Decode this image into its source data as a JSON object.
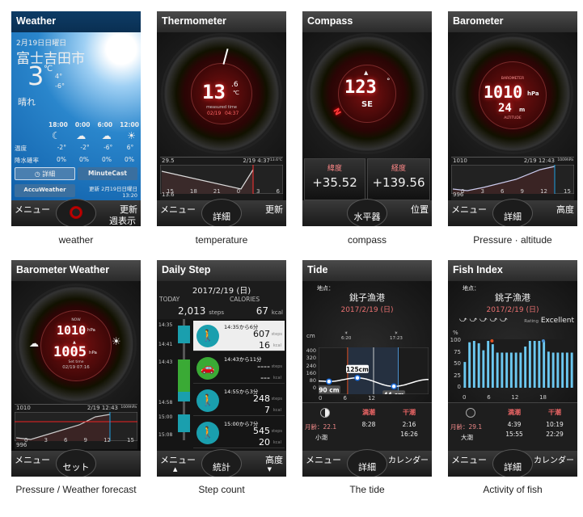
{
  "screens": [
    {
      "title": "Weather",
      "caption": "weather",
      "date": "2月19日日曜日",
      "city": "富士吉田市",
      "temp": "3",
      "unit": "℃",
      "high": "4°",
      "low": "-6°",
      "condition": "晴れ",
      "hours": [
        "18:00",
        "0:00",
        "6:00",
        "12:00"
      ],
      "hour_icons": [
        "moon-icon",
        "cloud-icon",
        "cloud-moon-icon",
        "sun-icon"
      ],
      "temp_label": "温度",
      "temps": [
        "-2°",
        "-2°",
        "-6°",
        "6°"
      ],
      "rain_label": "降水確率",
      "rains": [
        "0%",
        "0%",
        "0%",
        "0%"
      ],
      "detail_btn": "詳細",
      "minutecast": "MinuteCast",
      "accuweather": "AccuWeather",
      "updated": "更新 2月19日日曜日",
      "updated_time": "13:20",
      "nav": {
        "left": "メニュー",
        "right": "更新",
        "right2": "週表示"
      }
    },
    {
      "title": "Thermometer",
      "caption": "temperature",
      "value": "13",
      "decimal": ".6",
      "unit": "℃",
      "measured_label": "measured time",
      "measured_date": "02/19",
      "measured_time": "04:37",
      "chart_max": "29.5",
      "chart_min": "13.6",
      "chart_stamp": "2/19 4:37",
      "chart_stamp_val": "13.6℃",
      "ticks": [
        "15",
        "18",
        "21",
        "0",
        "3",
        "6"
      ],
      "nav": {
        "left": "メニュー",
        "center": "詳細",
        "right": "更新"
      }
    },
    {
      "title": "Compass",
      "caption": "compass",
      "heading": "123",
      "deg": "°",
      "direction": "SE",
      "lat_label": "緯度",
      "lat": "+35.52",
      "lon_label": "経度",
      "lon": "+139.56",
      "nav": {
        "center": "水平器",
        "right": "位置"
      }
    },
    {
      "title": "Barometer",
      "caption": "Pressure · altitude",
      "gauge_label": "BAROMETER",
      "pressure": "1010",
      "pressure_unit": "hPa",
      "altitude": "24",
      "altitude_unit": "m",
      "altitude_label": "ALTITUDE",
      "scale": [
        "900",
        "925",
        "950",
        "975",
        "1000",
        "1025",
        "1050"
      ],
      "chart_max": "1010",
      "chart_min": "996",
      "chart_stamp": "2/19 12:43",
      "chart_stamp_val": "1009hPa",
      "ticks": [
        "0",
        "3",
        "6",
        "9",
        "12",
        "15"
      ],
      "nav": {
        "left": "メニュー",
        "center": "詳細",
        "right": "高度"
      }
    },
    {
      "title": "Barometer Weather",
      "caption": "Pressure / Weather forecast",
      "now_label": "NOW",
      "now": "1010",
      "set": "1005",
      "unit": "hPa",
      "set_label": "Set time",
      "set_time": "02/19 07:16",
      "chart_max": "1010",
      "chart_min": "996",
      "chart_stamp": "2/19 12:43",
      "chart_stamp_val": "1009hPa",
      "ticks": [
        "0",
        "3",
        "6",
        "9",
        "12",
        "15"
      ],
      "nav": {
        "left": "メニュー",
        "center": "セット"
      }
    },
    {
      "title": "Daily Step",
      "caption": "Step count",
      "date": "2017/2/19 (日)",
      "today_label": "TODAY",
      "steps": "2,013",
      "steps_unit": "steps",
      "cal_label": "CALORIES",
      "cal": "67",
      "cal_unit": "kcal",
      "times": [
        "14:35",
        "14:41",
        "14:43",
        "14:58",
        "15:00",
        "15:08"
      ],
      "entries": [
        {
          "time": "14:35から6分",
          "steps": "607",
          "kcal": "16",
          "type": "walk",
          "color": "#1a9fae"
        },
        {
          "time": "14:43から11分",
          "steps": "----",
          "kcal": "---",
          "type": "vehicle",
          "color": "#3aaa35"
        },
        {
          "time": "14:55から3分",
          "steps": "248",
          "kcal": "7",
          "type": "walk",
          "color": "#1a9fae"
        },
        {
          "time": "15:00から7分",
          "steps": "545",
          "kcal": "20",
          "type": "walk",
          "color": "#1a9fae"
        }
      ],
      "nav": {
        "left": "メニュー",
        "center": "統計",
        "right": "高度"
      }
    },
    {
      "title": "Tide",
      "caption": "The tide",
      "loc_label": "地点：",
      "location": "銚子漁港",
      "date": "2017/2/19 (日)",
      "unit": "cm",
      "sunrise": "6:20",
      "sunset": "17:23",
      "yticks": [
        "400",
        "320",
        "240",
        "160",
        "80",
        "0"
      ],
      "xticks": [
        "0",
        "6",
        "12"
      ],
      "chart_data": {
        "type": "line",
        "x_unit": "hour",
        "y_unit": "cm",
        "points": [
          [
            0,
            95
          ],
          [
            2.27,
            90
          ],
          [
            8.47,
            125
          ],
          [
            16.43,
            44
          ],
          [
            24,
            110
          ]
        ],
        "ylim": [
          0,
          400
        ],
        "xlim": [
          0,
          24
        ],
        "labels": [
          "90 cm",
          "125cm",
          "44 cm"
        ]
      },
      "moon_label": "月齢：22.1",
      "tide_type": "小潮",
      "high_label": "満潮",
      "high": [
        "8:28"
      ],
      "low_label": "干潮",
      "low": [
        "2:16",
        "16:26"
      ],
      "nav": {
        "left": "メニュー",
        "center": "詳細",
        "right": "カレンダー"
      }
    },
    {
      "title": "Fish Index",
      "caption": "Activity of fish",
      "loc_label": "地点：",
      "location": "銚子漁港",
      "date": "2017/2/19 (日)",
      "rating_label": "Rating",
      "rating": "Excellent",
      "rating_level": 5,
      "chart_data": {
        "type": "bar",
        "ylabel": "%",
        "yticks": [
          "100",
          "75",
          "50",
          "25",
          "0"
        ],
        "xticks": [
          "0",
          "6",
          "12",
          "18"
        ],
        "ylim": [
          0,
          100
        ],
        "values": [
          55,
          97,
          100,
          95,
          80,
          100,
          93,
          75,
          75,
          75,
          75,
          75,
          75,
          88,
          100,
          100,
          100,
          100,
          77,
          75,
          75,
          75,
          75,
          75
        ]
      },
      "moon_label": "月齢：29.1",
      "tide_type": "大潮",
      "high_label": "満潮",
      "high": [
        "4:39",
        "15:55"
      ],
      "low_label": "干潮",
      "low": [
        "10:19",
        "22:29"
      ],
      "nav": {
        "left": "メニュー",
        "center": "詳細",
        "right": "カレンダー"
      }
    }
  ]
}
